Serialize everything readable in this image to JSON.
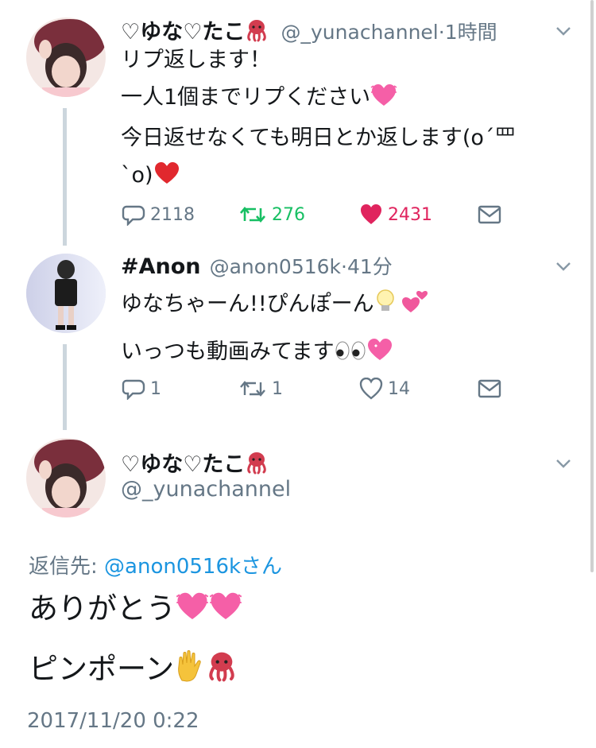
{
  "tweet1": {
    "name": "♡ゆな♡たこ",
    "handle": "@_yunachannel",
    "time": "1時間",
    "line1": "リプ返します！",
    "line2": "一人1個までリプください",
    "line3": "今日返せなくても明日とか返します(o´罒",
    "line4": "`o)",
    "replies": "2118",
    "retweets": "276",
    "likes": "2431"
  },
  "tweet2": {
    "name": "#Anon",
    "handle": "@anon0516k",
    "time": "41分",
    "line1": "ゆなちゃーん!!ぴんぽーん",
    "line2": "いっつも動画みてます",
    "replies": "1",
    "retweets": "1",
    "likes": "14"
  },
  "main": {
    "name": "♡ゆな♡たこ",
    "handle": "@_yunachannel",
    "reply_prefix": "返信先: ",
    "reply_to": "@anon0516kさん",
    "line1": "ありがとう",
    "line2": "ピンポーン",
    "timestamp": "2017/11/20 0:22"
  },
  "colors": {
    "retweet_active": "#17bf63",
    "like_active": "#e0245e",
    "link": "#1b95e0",
    "secondary": "#657786"
  }
}
